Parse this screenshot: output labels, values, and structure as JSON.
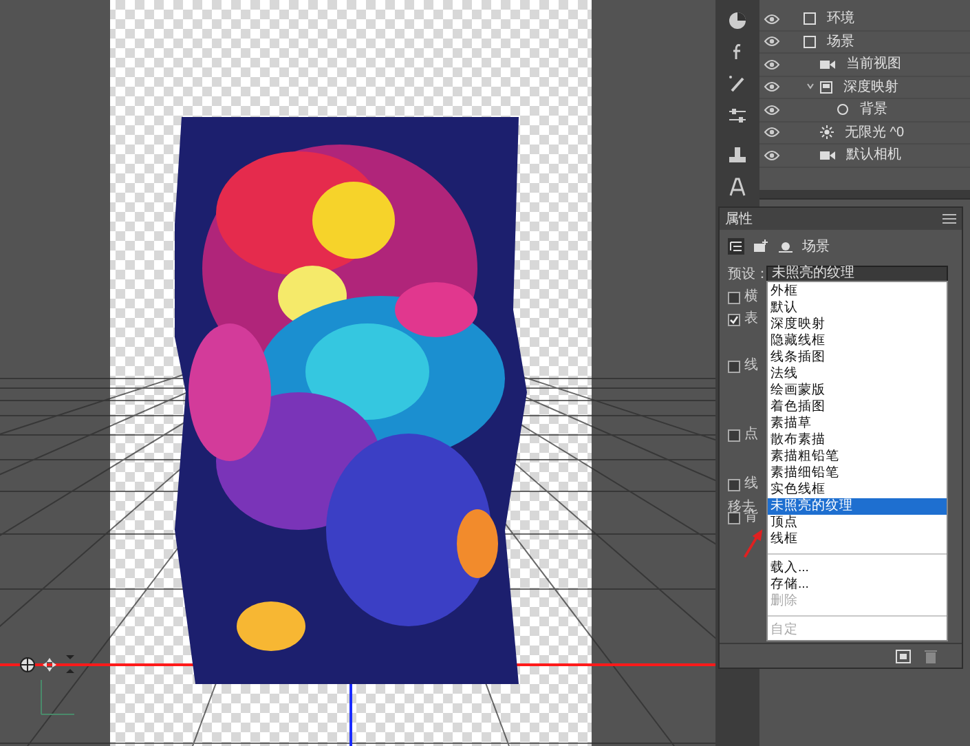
{
  "layers": [
    {
      "name": "环境"
    },
    {
      "name": "场景",
      "children": [
        {
          "name": "当前视图",
          "kind": "camera"
        },
        {
          "name": "深度映射",
          "kind": "mesh",
          "expanded": true,
          "children": [
            {
              "name": "背景",
              "kind": "material"
            }
          ]
        },
        {
          "name": "无限光 ^0",
          "kind": "light"
        },
        {
          "name": "默认相机",
          "kind": "camera"
        }
      ]
    }
  ],
  "properties": {
    "title": "属性",
    "tab_label": "场景",
    "preset_label": "预设：",
    "preset_value": "未照亮的纹理",
    "options": [
      {
        "kind": "checkbox",
        "label": "横",
        "checked": false
      },
      {
        "kind": "checkbox",
        "label": "表",
        "checked": true
      },
      {
        "kind": "checkbox",
        "label": "线",
        "checked": false
      },
      {
        "kind": "checkbox",
        "label": "点",
        "checked": false
      },
      {
        "kind": "checkbox",
        "label": "线",
        "checked": false
      },
      {
        "kind": "text",
        "label": "移去"
      },
      {
        "kind": "checkbox",
        "label": "背",
        "checked": false
      }
    ]
  },
  "preset_menu": [
    {
      "label": "外框",
      "selected": false,
      "disabled": false
    },
    {
      "label": "默认",
      "selected": false,
      "disabled": false
    },
    {
      "label": "深度映射",
      "selected": false,
      "disabled": false
    },
    {
      "label": "隐藏线框",
      "selected": false,
      "disabled": false
    },
    {
      "label": "线条插图",
      "selected": false,
      "disabled": false
    },
    {
      "label": "法线",
      "selected": false,
      "disabled": false
    },
    {
      "label": "绘画蒙版",
      "selected": false,
      "disabled": false
    },
    {
      "label": "着色插图",
      "selected": false,
      "disabled": false
    },
    {
      "label": "素描草",
      "selected": false,
      "disabled": false
    },
    {
      "label": "散布素描",
      "selected": false,
      "disabled": false
    },
    {
      "label": "素描粗铅笔",
      "selected": false,
      "disabled": false
    },
    {
      "label": "素描细铅笔",
      "selected": false,
      "disabled": false
    },
    {
      "label": "实色线框",
      "selected": false,
      "disabled": false
    },
    {
      "label": "未照亮的纹理",
      "selected": true,
      "disabled": false
    },
    {
      "label": "顶点",
      "selected": false,
      "disabled": false
    },
    {
      "label": "线框",
      "selected": false,
      "disabled": false,
      "separator_after": true
    },
    {
      "label": "载入...",
      "selected": false,
      "disabled": false
    },
    {
      "label": "存储...",
      "selected": false,
      "disabled": false
    },
    {
      "label": "删除",
      "selected": false,
      "disabled": true,
      "separator_after": true
    },
    {
      "label": "自定",
      "selected": false,
      "disabled": true
    }
  ]
}
